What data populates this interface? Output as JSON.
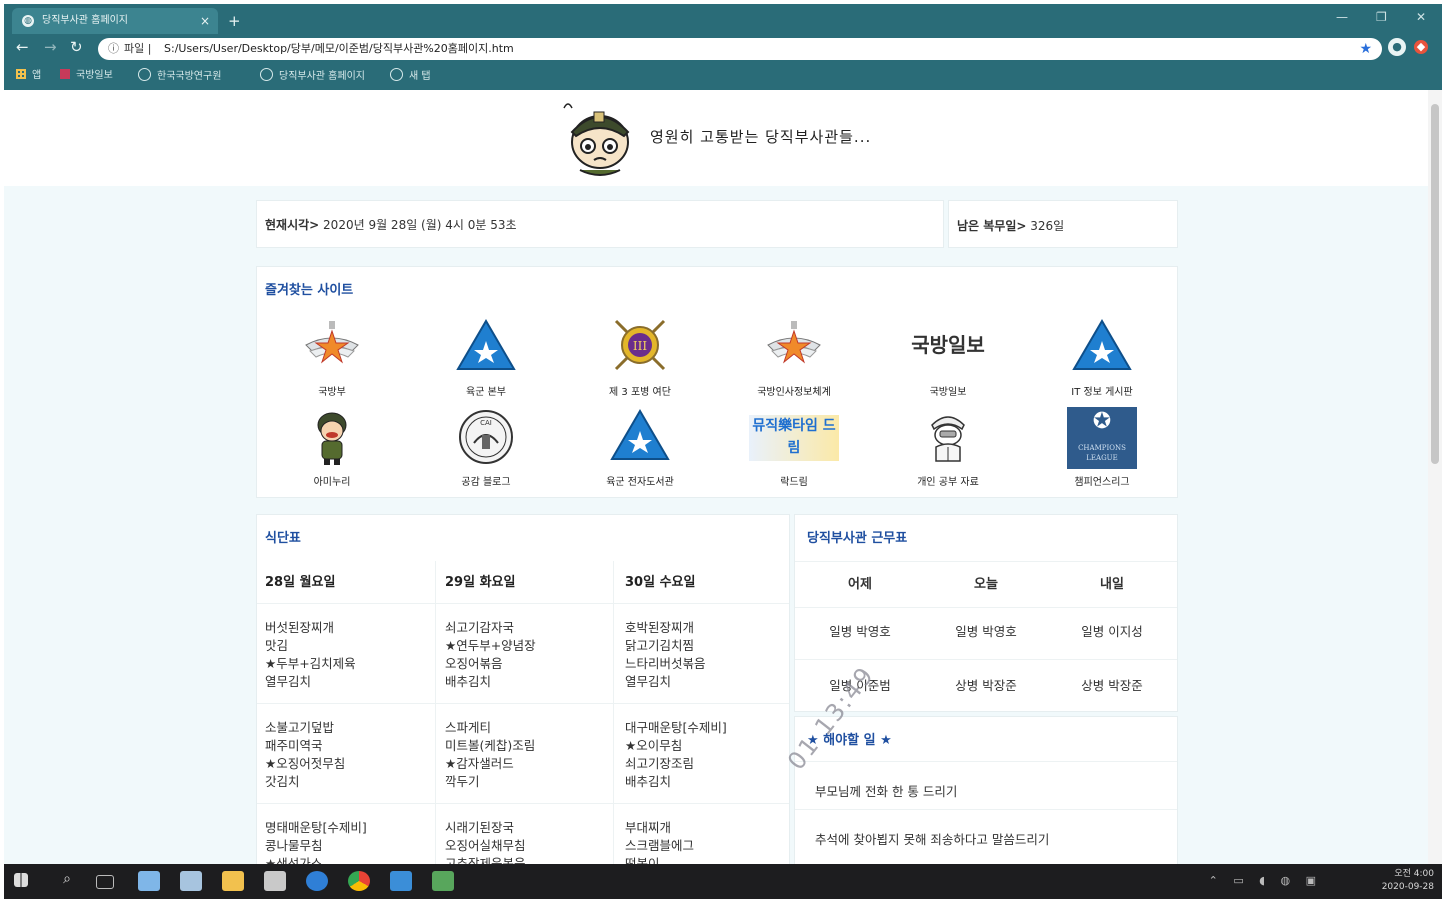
{
  "browser": {
    "tab_title": "당직부사관 홈페이지",
    "tab_close": "×",
    "new_tab": "+",
    "window_controls": {
      "minimize": "—",
      "maximize": "❐",
      "close": "✕"
    },
    "nav": {
      "back": "←",
      "forward": "→",
      "reload": "↻"
    },
    "address": {
      "info_icon": "ⓘ",
      "scheme": "파일 |",
      "url": "S:/Users/User/Desktop/당부/메모/이준범/당직부사관%20홈페이지.htm",
      "star": "★"
    },
    "bookmarks": [
      {
        "label": "앱",
        "icon": "apps-grid-icon"
      },
      {
        "label": "국방일보",
        "icon": "newspaper-icon"
      },
      {
        "label": "한국국방연구원",
        "icon": "globe-icon"
      },
      {
        "label": "당직부사관 홈페이지",
        "icon": "globe-icon"
      },
      {
        "label": "새 탭",
        "icon": "globe-icon"
      }
    ]
  },
  "header": {
    "slogan": "영원히 고통받는 당직부사관들..."
  },
  "status": {
    "time_label": "현재시각>",
    "time_value": "2020년 9월 28일 (월) 4시 0분 53초",
    "remain_label": "남은 복무일>",
    "remain_value": "326일"
  },
  "favorites": {
    "title": "즐겨찾는 사이트",
    "items": [
      {
        "label": "국방부",
        "icon": "mnd-emblem-icon"
      },
      {
        "label": "육군 본부",
        "icon": "army-triangle-icon"
      },
      {
        "label": "제 3 포병 여단",
        "icon": "artillery-brigade-emblem-icon"
      },
      {
        "label": "국방인사정보체계",
        "icon": "mnd-emblem-icon"
      },
      {
        "label": "국방일보",
        "icon": "kookbang-ilbo-logo",
        "logo_text": "국방일보"
      },
      {
        "label": "IT 정보 게시판",
        "icon": "army-triangle-icon"
      },
      {
        "label": "아미누리",
        "icon": "soldier-character-icon"
      },
      {
        "label": "공감 블로그",
        "icon": "seal-emblem-icon",
        "seal_text": "CAI"
      },
      {
        "label": "육군 전자도서관",
        "icon": "army-triangle-icon"
      },
      {
        "label": "락드림",
        "icon": "music-time-banner-icon",
        "logo_text": "뮤직樂타임 드림"
      },
      {
        "label": "개인 공부 자료",
        "icon": "soldier-sketch-icon"
      },
      {
        "label": "챔피언스리그",
        "icon": "champions-league-icon",
        "logo_text": "CHAMPIONS LEAGUE"
      }
    ]
  },
  "menu": {
    "title": "식단표",
    "days": [
      {
        "label": "28일 월요일",
        "meals": [
          [
            "버섯된장찌개",
            "맛김",
            "★두부+김치제육",
            "열무김치"
          ],
          [
            "소불고기덮밥",
            "패주미역국",
            "★오징어젓무침",
            "갓김치"
          ],
          [
            "명태매운탕[수제비]",
            "콩나물무침",
            "★생선가스"
          ]
        ]
      },
      {
        "label": "29일 화요일",
        "meals": [
          [
            "쇠고기감자국",
            "★연두부+양념장",
            "오징어볶음",
            "배추김치"
          ],
          [
            "스파게티",
            "미트볼(케찹)조림",
            "★감자샐러드",
            "깍두기"
          ],
          [
            "시래기된장국",
            "오징어실채무침",
            "고추잡제육볶음"
          ]
        ]
      },
      {
        "label": "30일 수요일",
        "meals": [
          [
            "호박된장찌개",
            "닭고기김치찜",
            "느타리버섯볶음",
            "열무김치"
          ],
          [
            "대구매운탕[수제비]",
            "★오이무침",
            "쇠고기장조림",
            "배추김치"
          ],
          [
            "부대찌개",
            "스크램블에그",
            "떡볶이"
          ]
        ]
      }
    ]
  },
  "duty": {
    "title": "당직부사관 근무표",
    "headers": [
      "어제",
      "오늘",
      "내일"
    ],
    "rows": [
      [
        "일병 박영호",
        "일병 박영호",
        "일병 이지성"
      ],
      [
        "일병 이준범",
        "상병 박장준",
        "상병 박장준"
      ]
    ]
  },
  "todo": {
    "title": "★ 해야할 일 ★",
    "items": [
      "부모님께 전화 한 통 드리기",
      "추석에 찾아뵙지 못해 죄송하다고 말씀드리기"
    ]
  },
  "scan_stamp": "01 13:49",
  "taskbar": {
    "clock_time": "오전 4:00",
    "clock_date": "2020-09-28",
    "apps": [
      "start-icon",
      "search-icon",
      "task-view-icon",
      "notepad-icon",
      "paint-icon",
      "folder-icon",
      "calculator-icon",
      "edge-icon",
      "chrome-icon",
      "app-icon",
      "image-icon"
    ]
  },
  "colors": {
    "chrome": "#2a6c78",
    "page_bg": "#f1f9fb",
    "title_blue": "#1f4fa0",
    "army_blue": "#1f7fd0",
    "taskbar": "#1d1d1f"
  }
}
